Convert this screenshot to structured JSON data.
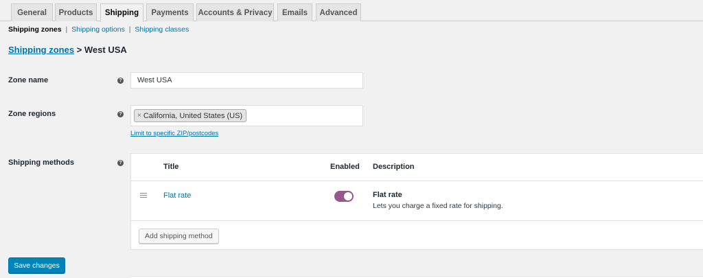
{
  "tabs": [
    {
      "label": "General"
    },
    {
      "label": "Products"
    },
    {
      "label": "Shipping"
    },
    {
      "label": "Payments"
    },
    {
      "label": "Accounts & Privacy"
    },
    {
      "label": "Emails"
    },
    {
      "label": "Advanced"
    }
  ],
  "active_tab": "Shipping",
  "subnav": {
    "zones": "Shipping zones",
    "options": "Shipping options",
    "classes": "Shipping classes",
    "separator": "|"
  },
  "breadcrumb": {
    "link": "Shipping zones",
    "rest": " > West USA"
  },
  "form": {
    "zone_name_label": "Zone name",
    "zone_name_value": "West USA",
    "zone_regions_label": "Zone regions",
    "region_token": "California, United States (US)",
    "token_remove": "×",
    "zip_link": "Limit to specific ZIP/postcodes",
    "methods_label": "Shipping methods",
    "help_glyph": "?"
  },
  "methods_table": {
    "col_title": "Title",
    "col_enabled": "Enabled",
    "col_description": "Description",
    "rows": [
      {
        "title": "Flat rate",
        "enabled": true,
        "desc_name": "Flat rate",
        "desc_text": "Lets you charge a fixed rate for shipping."
      }
    ],
    "add_button": "Add shipping method"
  },
  "save_button": "Save changes",
  "colors": {
    "link": "#0073aa",
    "toggle_on": "#96588a",
    "primary_button": "#0085ba"
  }
}
